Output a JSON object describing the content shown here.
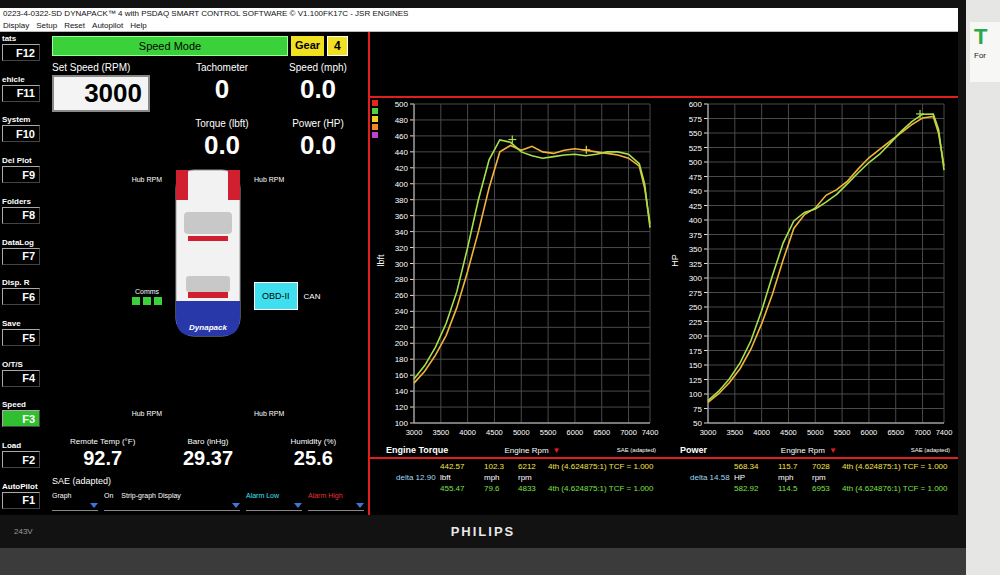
{
  "window": {
    "title": "0223-4-0322-SD DYNAPACK™ 4 with PSDAQ SMART CONTROL SOFTWARE © V1.100FK17C - JSR ENGINES"
  },
  "menu": [
    "Display",
    "Setup",
    "Reset",
    "Autopilot",
    "Help"
  ],
  "function_keys": [
    {
      "label": "tats",
      "key": "F12",
      "selected": false
    },
    {
      "label": "ehicle",
      "key": "F11",
      "selected": false
    },
    {
      "label": "System",
      "key": "F10",
      "selected": false
    },
    {
      "label": "Del Plot",
      "key": "F9",
      "selected": false
    },
    {
      "label": "Folders",
      "key": "F8",
      "selected": false
    },
    {
      "label": "DataLog",
      "key": "F7",
      "selected": false
    },
    {
      "label": "Disp. R",
      "key": "F6",
      "selected": false
    },
    {
      "label": "Save",
      "key": "F5",
      "selected": false
    },
    {
      "label": "O/T/S",
      "key": "F4",
      "selected": false
    },
    {
      "label": "Speed",
      "key": "F3",
      "selected": true
    },
    {
      "label": "Load",
      "key": "F2",
      "selected": false
    },
    {
      "label": "AutoPilot",
      "key": "F1",
      "selected": false
    }
  ],
  "mode": {
    "label": "Speed Mode",
    "gear_label": "Gear",
    "gear": "4"
  },
  "set_speed": {
    "label": "Set Speed (RPM)",
    "value": "3000"
  },
  "readouts": [
    {
      "label": "Tachometer",
      "value": "0"
    },
    {
      "label": "Speed (mph)",
      "value": "0.0"
    },
    {
      "label": "Torque (lbft)",
      "value": "0.0"
    },
    {
      "label": "Power (HP)",
      "value": "0.0"
    }
  ],
  "car": {
    "hubs": [
      "Hub RPM",
      "Hub RPM",
      "Hub RPM",
      "Hub RPM"
    ],
    "badge": "Dynapack",
    "comms": "Comms",
    "comms_lights": [
      {
        "on": true
      },
      {
        "on": true
      },
      {
        "on": true
      }
    ],
    "obd": "OBD-II",
    "can": "CAN"
  },
  "environment": [
    {
      "label": "Remote Temp (°F)",
      "value": "92.7"
    },
    {
      "label": "Baro (inHg)",
      "value": "29.37"
    },
    {
      "label": "Humidity (%)",
      "value": "25.6"
    }
  ],
  "sae": "SAE (adapted)",
  "graph_controls": {
    "graph": "Graph",
    "on": "On",
    "strip": "Strip-graph Display",
    "alarm_low": "Alarm Low",
    "alarm_high": "Alarm High"
  },
  "legend_swatches": [
    {
      "color": "#e02a20"
    },
    {
      "color": "#50d040"
    },
    {
      "color": "#f0d020"
    },
    {
      "color": "#f08a20"
    },
    {
      "color": "#c040d0"
    }
  ],
  "charts": [
    {
      "title": "Engine Torque",
      "y_label": "lbft",
      "x_label": "Engine Rpm",
      "x_arrow": "▼",
      "note": "SAE (adapted)",
      "y_ticks": [
        "100",
        "120",
        "140",
        "160",
        "180",
        "200",
        "220",
        "240",
        "260",
        "280",
        "300",
        "320",
        "340",
        "360",
        "380",
        "400",
        "420",
        "440",
        "460",
        "480",
        "500"
      ],
      "x_ticks": [
        "3000",
        "3500",
        "4000",
        "4500",
        "5000",
        "5500",
        "6000",
        "6500",
        "7000",
        "7400"
      ],
      "x_values": [
        3000,
        3200,
        3400,
        3600,
        3800,
        4000,
        4200,
        4400,
        4600,
        4800,
        5000,
        5200,
        5400,
        5600,
        5800,
        6000,
        6200,
        6400,
        6600,
        6800,
        7000,
        7200,
        7300,
        7400
      ],
      "series": [
        {
          "color": "#f2b53a",
          "values": [
            150,
            165,
            185,
            210,
            245,
            290,
            340,
            395,
            440,
            448,
            442,
            447,
            440,
            438,
            442,
            444,
            442,
            440,
            438,
            436,
            432,
            422,
            395,
            350
          ]
        },
        {
          "color": "#a8e04a",
          "values": [
            155,
            172,
            195,
            225,
            265,
            320,
            380,
            430,
            455,
            452,
            440,
            435,
            432,
            434,
            436,
            437,
            435,
            437,
            440,
            440,
            437,
            425,
            400,
            345
          ]
        }
      ],
      "markers": [
        {
          "x": 4833,
          "y": 455.47,
          "color": "#a8e04a"
        },
        {
          "x": 6212,
          "y": 442.57,
          "color": "#f2d040"
        }
      ],
      "readout": {
        "row1": [
          "442.57",
          "102.3",
          "6212",
          "4th (4.624875:1) TCF = 1.000"
        ],
        "delta": "delta 12.90",
        "units": [
          "lbft",
          "mph",
          "rpm"
        ],
        "row2": [
          "455.47",
          "79.6",
          "4833",
          "4th (4.624875:1) TCF = 1.000"
        ],
        "row1_color": "#f4e44a",
        "row2_color": "#7ee04a"
      }
    },
    {
      "title": "Power",
      "y_label": "HP",
      "x_label": "Engine Rpm",
      "x_arrow": "▼",
      "note": "SAE (adapted)",
      "y_ticks": [
        "50",
        "75",
        "100",
        "125",
        "150",
        "175",
        "200",
        "225",
        "250",
        "275",
        "300",
        "325",
        "350",
        "375",
        "400",
        "425",
        "450",
        "475",
        "500",
        "525",
        "550",
        "575",
        "600"
      ],
      "x_ticks": [
        "3000",
        "3500",
        "4000",
        "4500",
        "5000",
        "5500",
        "6000",
        "6500",
        "7000",
        "7400"
      ],
      "x_values": [
        3000,
        3200,
        3400,
        3600,
        3800,
        4000,
        4200,
        4400,
        4600,
        4800,
        5000,
        5200,
        5400,
        5600,
        5800,
        6000,
        6200,
        6400,
        6600,
        6800,
        7000,
        7200,
        7300,
        7400
      ],
      "series": [
        {
          "color": "#f2b53a",
          "values": [
            85.7,
            100.5,
            119.8,
            143.9,
            177.3,
            220.9,
            271.9,
            330.9,
            385.4,
            409.4,
            420.8,
            442.6,
            452.4,
            467.0,
            488.1,
            507.2,
            521.8,
            536.2,
            550.4,
            564.5,
            575.8,
            578.5,
            549.0,
            493.1
          ]
        },
        {
          "color": "#a8e04a",
          "values": [
            88.5,
            104.8,
            126.2,
            154.2,
            191.7,
            243.7,
            303.9,
            360.2,
            398.5,
            413.1,
            418.9,
            430.7,
            444.2,
            462.8,
            481.5,
            499.2,
            513.5,
            532.5,
            552.9,
            569.7,
            582.4,
            582.6,
            556.0,
            486.1
          ]
        }
      ],
      "markers": [
        {
          "x": 6953,
          "y": 582.92,
          "color": "#a8e04a"
        }
      ],
      "readout": {
        "row1": [
          "568.34",
          "115.7",
          "7028",
          "4th (4.624875:1) TCF = 1.000"
        ],
        "delta": "delta 14.58",
        "units": [
          "HP",
          "mph",
          "rpm"
        ],
        "row2": [
          "582.92",
          "114.5",
          "6953",
          "4th (4.624876:1) TCF = 1.000"
        ],
        "row1_color": "#f4e44a",
        "row2_color": "#7ee04a"
      }
    }
  ],
  "monitor": {
    "model": "243V",
    "brand": "PHILIPS"
  },
  "wall_sign": {
    "logo": "T",
    "text": "For"
  }
}
